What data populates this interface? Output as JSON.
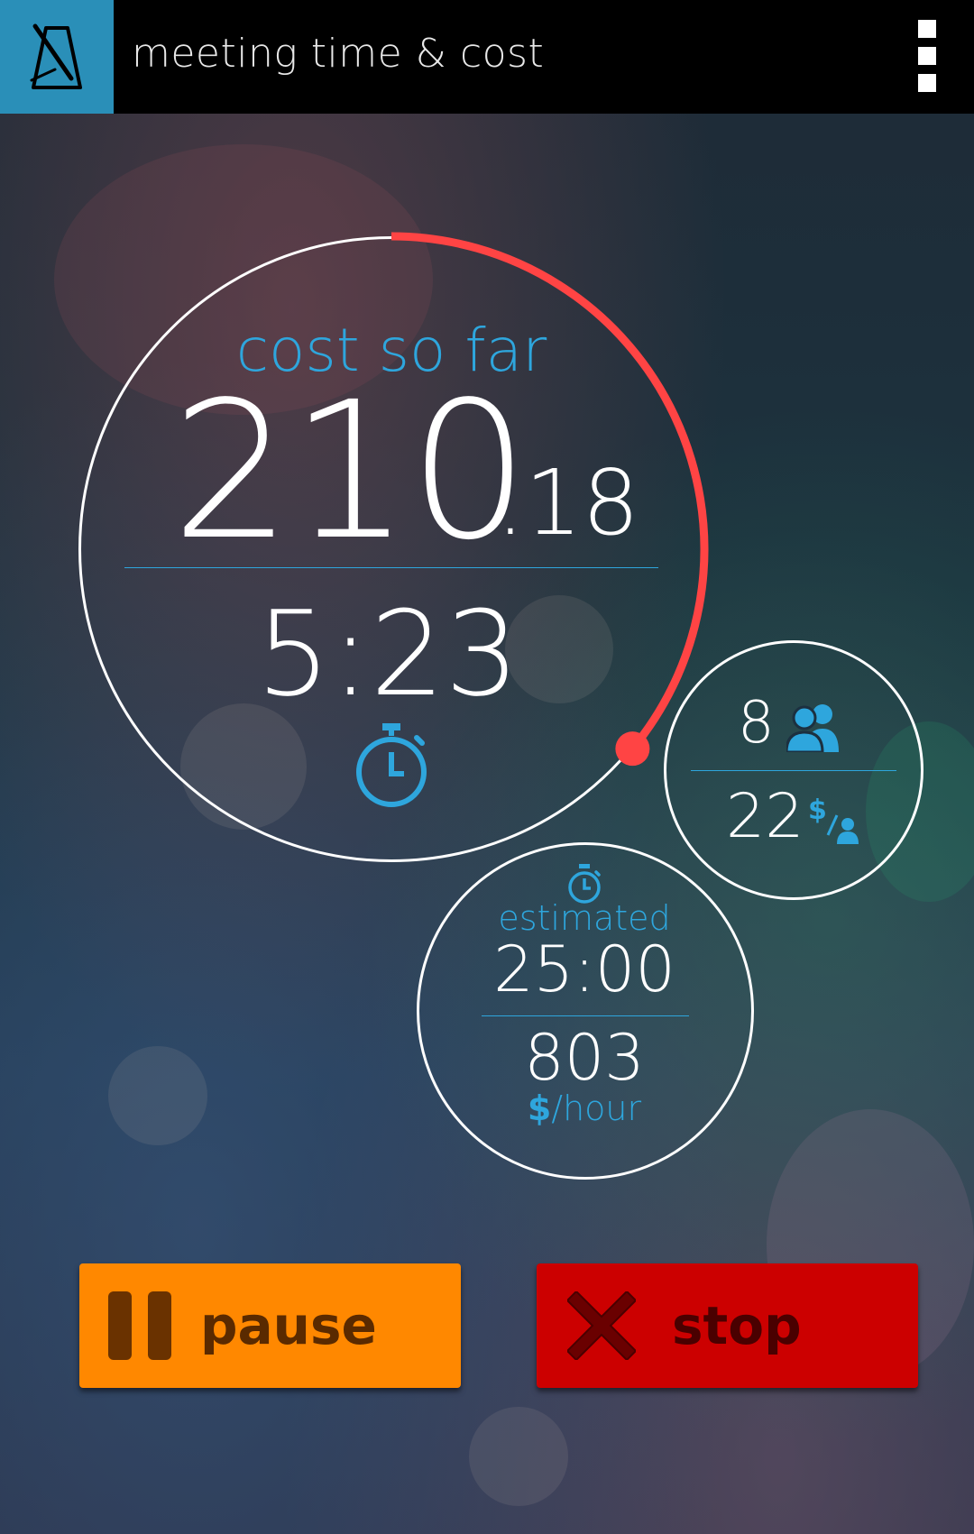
{
  "app": {
    "title": "meeting time & cost",
    "icon": "metronome-icon",
    "menu_icon": "overflow-menu-icon"
  },
  "colors": {
    "accent": "#2ea6dd",
    "progress": "#ff4444",
    "pause": "#ff8800",
    "stop": "#cc0000"
  },
  "cost": {
    "label": "cost so far",
    "whole": "210",
    "cents": ".18",
    "progress_fraction": 0.36
  },
  "elapsed": {
    "time": "5:23",
    "icon": "stopwatch-icon"
  },
  "attendees": {
    "count": "8",
    "count_icon": "people-icon",
    "rate": "22",
    "rate_icon": "dollar-per-person-icon"
  },
  "estimate": {
    "icon": "stopwatch-icon",
    "label": "estimated",
    "time": "25:00",
    "hourly_value": "803",
    "hourly_symbol": "$",
    "hourly_unit": "/hour"
  },
  "buttons": {
    "pause": "pause",
    "stop": "stop"
  }
}
